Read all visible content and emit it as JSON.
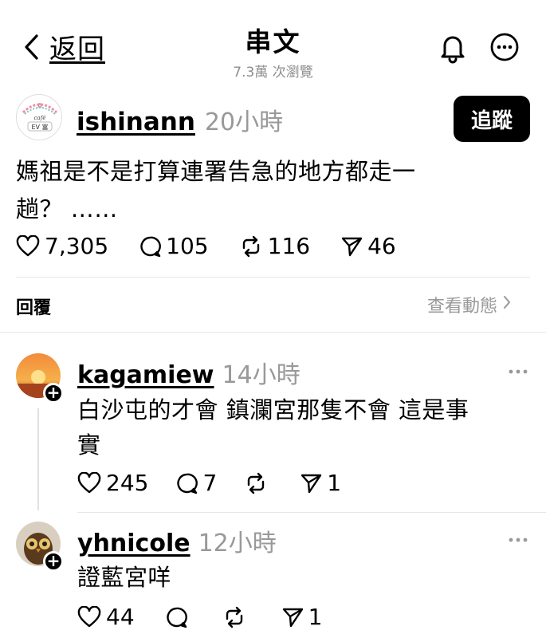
{
  "header": {
    "back_label": "返回",
    "title": "串文",
    "subtitle": "7.3萬 次瀏覽"
  },
  "post": {
    "username": "ishinann",
    "time": "20小時",
    "follow_label": "追蹤",
    "text_line1": "媽祖是不是打算連署告急的地方都走一",
    "text_line2": "趟？ ……",
    "likes": "7,305",
    "comments": "105",
    "reposts": "116",
    "shares": "46"
  },
  "replies_section": {
    "label": "回覆",
    "view_activity": "查看動態"
  },
  "comments": [
    {
      "username": "kagamiew",
      "time": "14小時",
      "text_line1": "白沙屯的才會 鎮瀾宮那隻不會 這是事",
      "text_line2": "實",
      "likes": "245",
      "comments": "7",
      "reposts": "",
      "shares": "1"
    },
    {
      "username": "yhnicole",
      "time": "12小時",
      "text_line1": "證藍宮咩",
      "likes": "44",
      "comments": "",
      "reposts": "",
      "shares": "1"
    }
  ],
  "avatar_text": {
    "top": "A",
    "mid": "café",
    "bottom": "EV 富"
  },
  "colors": {
    "accent": "#000000",
    "muted": "#999999",
    "divider": "#e6e6e6"
  }
}
